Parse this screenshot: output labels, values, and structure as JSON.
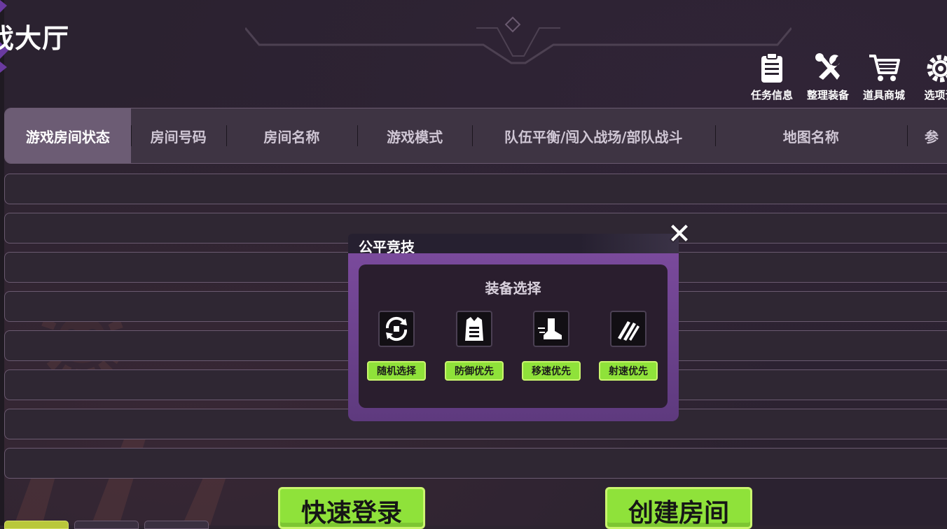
{
  "header": {
    "title": "戏大厅"
  },
  "top_menu": [
    {
      "label": "任务信息",
      "icon": "clipboard-icon"
    },
    {
      "label": "整理装备",
      "icon": "tools-icon"
    },
    {
      "label": "道具商城",
      "icon": "cart-icon"
    },
    {
      "label": "选项设",
      "icon": "gear-icon"
    }
  ],
  "table": {
    "columns": [
      "游戏房间状态",
      "房间号码",
      "房间名称",
      "游戏模式",
      "队伍平衡/闯入战场/部队战斗",
      "地图名称",
      "参"
    ],
    "active_column": 0,
    "row_count": 8
  },
  "modal": {
    "title": "公平竞技",
    "section_title": "装备选择",
    "options": [
      {
        "label": "随机选择",
        "icon": "random-cycle-icon"
      },
      {
        "label": "防御优先",
        "icon": "armor-vest-icon"
      },
      {
        "label": "移速优先",
        "icon": "speed-boot-icon"
      },
      {
        "label": "射速优先",
        "icon": "bullets-icon"
      }
    ]
  },
  "buttons": {
    "quick_login": "快速登录",
    "create_room": "创建房间"
  },
  "colors": {
    "accent_green": "#8fe23a",
    "modal_purple": "#6c4490",
    "background": "#2b2230"
  }
}
